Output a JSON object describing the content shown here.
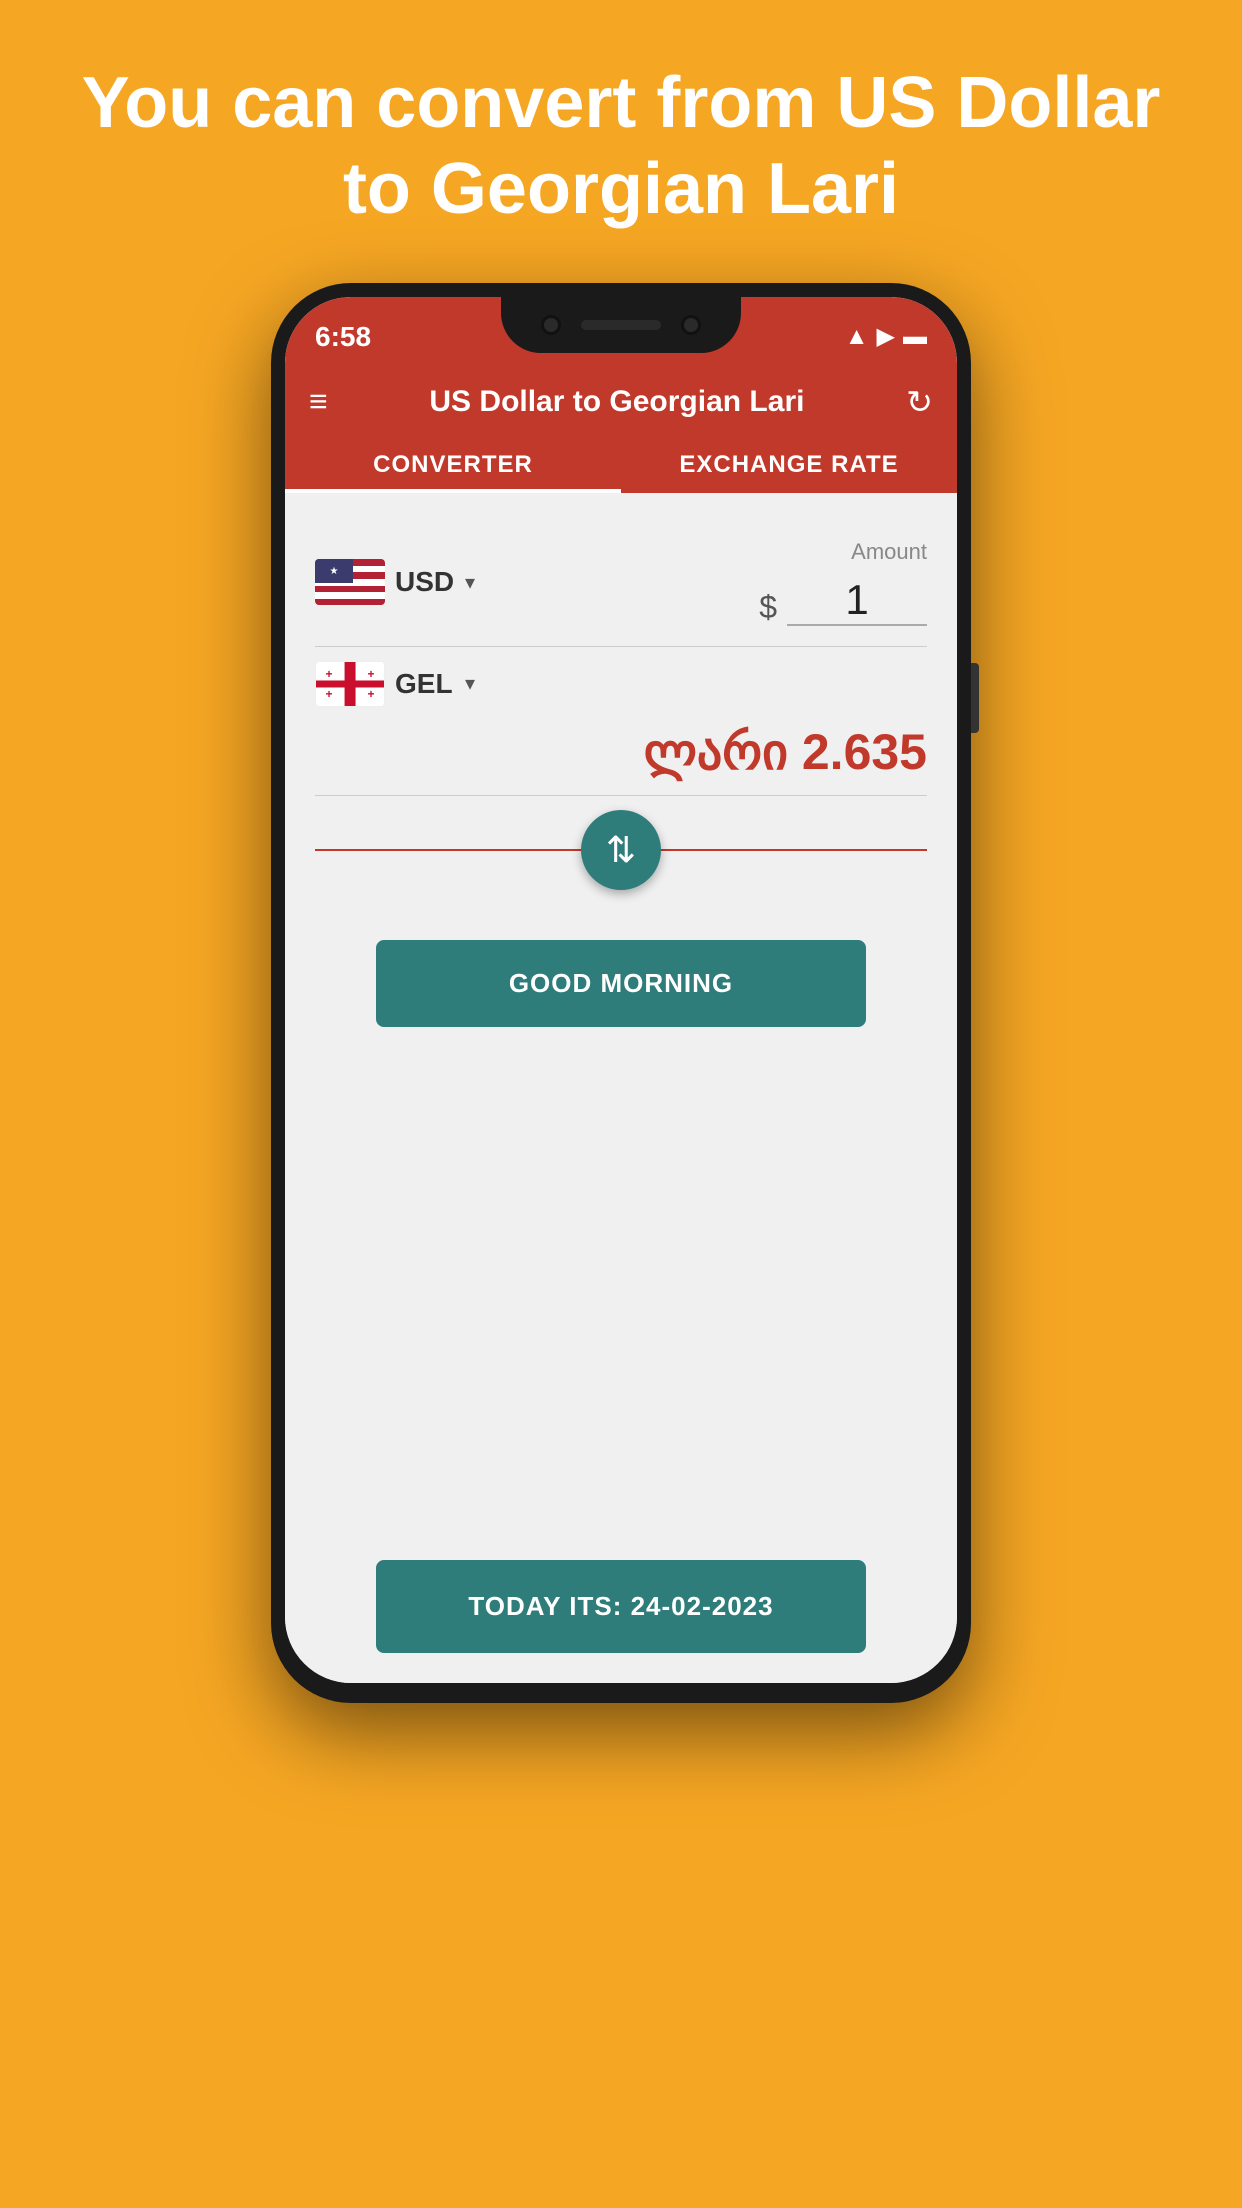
{
  "promo": {
    "text": "You can convert from US Dollar to Georgian Lari"
  },
  "statusBar": {
    "time": "6:58",
    "icons": [
      "sim",
      "wifi",
      "signal",
      "battery"
    ]
  },
  "appBar": {
    "title": "US Dollar to Georgian Lari",
    "menuIcon": "≡",
    "refreshIcon": "↻"
  },
  "tabs": [
    {
      "label": "CONVERTER",
      "active": true
    },
    {
      "label": "EXCHANGE RATE",
      "active": false
    }
  ],
  "converter": {
    "fromCurrency": {
      "code": "USD",
      "symbol": "$",
      "flagType": "us"
    },
    "toCurrency": {
      "code": "GEL",
      "symbol": "₾",
      "flagType": "gel"
    },
    "amountLabel": "Amount",
    "amountValue": "1",
    "convertedValue": "ლარი 2.635",
    "swapIcon": "⇅"
  },
  "buttons": {
    "greetingLabel": "GOOD MORNING",
    "dateLabel": "TODAY ITS: 24-02-2023"
  }
}
